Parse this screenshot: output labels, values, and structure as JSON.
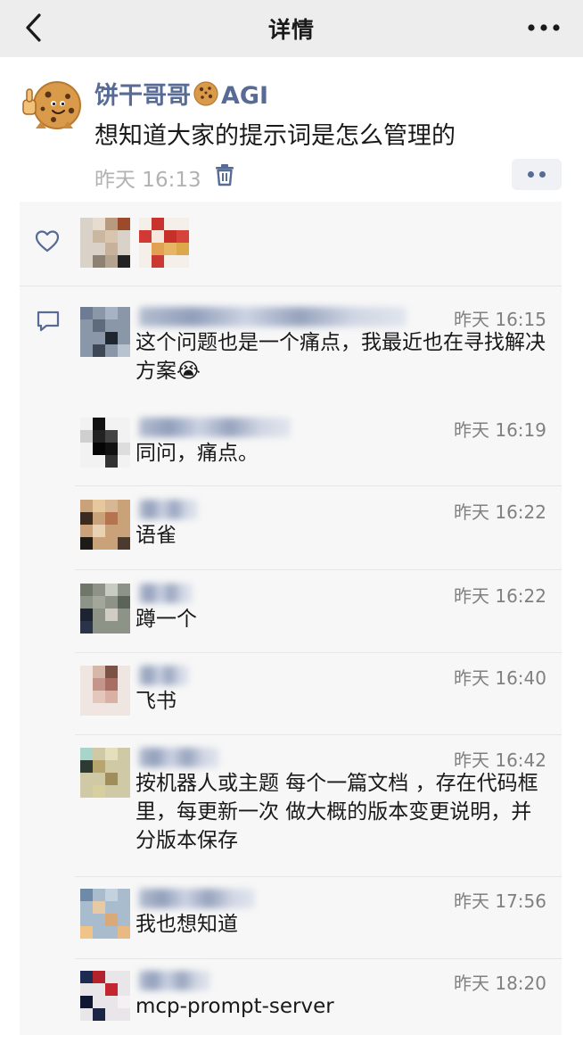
{
  "navbar": {
    "title": "详情",
    "back_icon": "chevron-left-icon",
    "more_icon": "more-dots-icon"
  },
  "post": {
    "author_name_prefix": "饼干哥哥",
    "author_name_suffix": "AGI",
    "author_emoji": "cookie",
    "text": "想知道大家的提示词是怎么管理的",
    "time": "昨天 16:13",
    "delete_icon": "trash-icon",
    "action_icon": "two-dots-icon"
  },
  "likes": {
    "icon": "heart-outline-icon",
    "count_shown": 2
  },
  "comments": [
    {
      "time": "昨天 16:15",
      "text": "这个问题也是一个痛点，我最近也在寻找解决方案😭"
    },
    {
      "time": "昨天 16:19",
      "text": "同问，痛点。"
    },
    {
      "time": "昨天 16:22",
      "text": "语雀"
    },
    {
      "time": "昨天 16:22",
      "text": "蹲一个"
    },
    {
      "time": "昨天 16:40",
      "text": "飞书"
    },
    {
      "time": "昨天 16:42",
      "text": "按机器人或主题 每个一篇文档 ，存在代码框里，每更新一次 做大概的版本变更说明，并分版本保存"
    },
    {
      "time": "昨天 17:56",
      "text": "我也想知道"
    },
    {
      "time": "昨天 18:20",
      "text": "mcp-prompt-server"
    }
  ],
  "comment_icon": "comment-bubble-icon",
  "colors": {
    "link_blue": "#576b95",
    "nav_bg": "#ededed",
    "panel_bg": "#f7f7f7",
    "muted_text": "#b2b2b2"
  }
}
